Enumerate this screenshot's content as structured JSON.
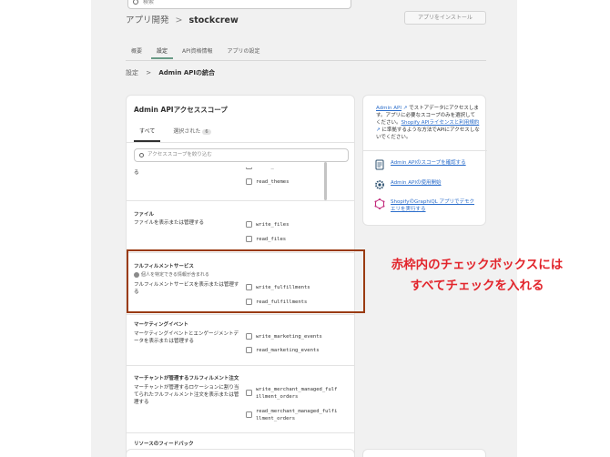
{
  "topbar": {
    "search_placeholder": "検索"
  },
  "header": {
    "breadcrumb_parent": "アプリ開発",
    "separator": ">",
    "app_name": "stockcrew",
    "install_button": "アプリをインストール"
  },
  "tabs": [
    {
      "label": "概要"
    },
    {
      "label": "設定"
    },
    {
      "label": "API資格情報"
    },
    {
      "label": "アプリの設定"
    }
  ],
  "breadcrumb": {
    "parent": "設定",
    "separator": ">",
    "current": "Admin APIの統合"
  },
  "scopes_card": {
    "title": "Admin APIアクセススコープ",
    "subtab_all": "すべて",
    "subtab_selected": "選択された",
    "selected_count": "6",
    "filter_placeholder": "アクセススコープを絞り込む",
    "sections": [
      {
        "title": "",
        "desc": "オンラインストアのテーマを表示または管理する",
        "scopes": [
          "write_themes",
          "read_themes"
        ]
      },
      {
        "title": "ファイル",
        "desc": "ファイルを表示または管理する",
        "scopes": [
          "write_files",
          "read_files"
        ]
      },
      {
        "title": "フルフィルメントサービス",
        "note": "個人を特定できる情報が含まれる",
        "desc": "フルフィルメントサービスを表示または管理する",
        "scopes": [
          "write_fulfillments",
          "read_fulfillments"
        ]
      },
      {
        "title": "マーケティングイベント",
        "desc": "マーケティングイベントとエンゲージメントデータを表示または管理する",
        "scopes": [
          "write_marketing_events",
          "read_marketing_events"
        ]
      },
      {
        "title": "マーチャントが管理するフルフィルメント注文",
        "desc": "マーチャントが管理するロケーションに割り当てられたフルフィルメント注文を表示または管理する",
        "scopes": [
          "write_merchant_managed_fulfillment_orders",
          "read_merchant_managed_fulfillment_orders"
        ]
      },
      {
        "title": "リソースのフィードバック",
        "desc": "",
        "scopes": []
      }
    ]
  },
  "info_card": {
    "admin_api_link": "Admin API",
    "text_1": "でストアデータにアクセスします。アプリに必要なスコープのみを選択してください。",
    "license_link": "Shopify APIライセンスと利用規約",
    "text_2": "に準拠するような方法でAPIにアクセスしないでください。",
    "links": [
      {
        "label": "Admin APIのスコープを確認する",
        "icon": "document-icon"
      },
      {
        "label": "Admin APIの使用開始",
        "icon": "gear-icon"
      },
      {
        "label": "ShopifyのGraphiQL アプリでデモクエリを実行する",
        "icon": "graphql-icon"
      }
    ]
  },
  "annotation": {
    "line1": "赤枠内のチェックボックスには",
    "line2": "すべてチェックを入れる",
    "color": "#e2252c",
    "box_color": "#9a3b12"
  },
  "colors": {
    "accent_tab": "#6a9b87",
    "link": "#2c6ecb",
    "bg": "#f1f1f1"
  }
}
